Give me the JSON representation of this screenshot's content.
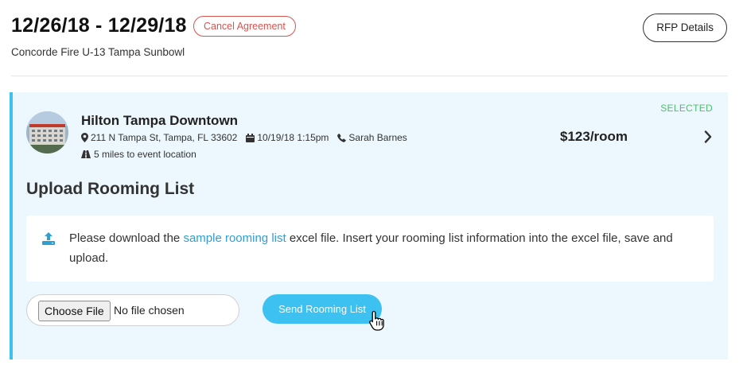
{
  "header": {
    "dates": "12/26/18 - 12/29/18",
    "cancel_label": "Cancel Agreement",
    "subtitle": "Concorde Fire U-13 Tampa Sunbowl",
    "rfp_label": "RFP Details"
  },
  "hotel": {
    "status": "SELECTED",
    "name": "Hilton Tampa Downtown",
    "address": "211 N Tampa St, Tampa, FL 33602",
    "datetime": "10/19/18 1:15pm",
    "contact": "Sarah Barnes",
    "distance": "5 miles to event location",
    "price": "$123/room"
  },
  "upload": {
    "title": "Upload Rooming List",
    "text_before": "Please download the ",
    "link_text": "sample rooming list",
    "text_after": " excel file. Insert your rooming list information into the excel file, save and upload.",
    "choose_label": "Choose File",
    "no_file": "No file chosen",
    "send_label": "Send Rooming List"
  },
  "colors": {
    "accent": "#3cc1f0",
    "danger": "#d9534f",
    "selected": "#4cc06d",
    "link": "#2d9fd0",
    "panel_bg": "#ecf8fd"
  },
  "icons": [
    "map-marker-icon",
    "calendar-icon",
    "phone-icon",
    "road-icon",
    "chevron-right-icon",
    "upload-icon",
    "hand-pointer-icon"
  ]
}
